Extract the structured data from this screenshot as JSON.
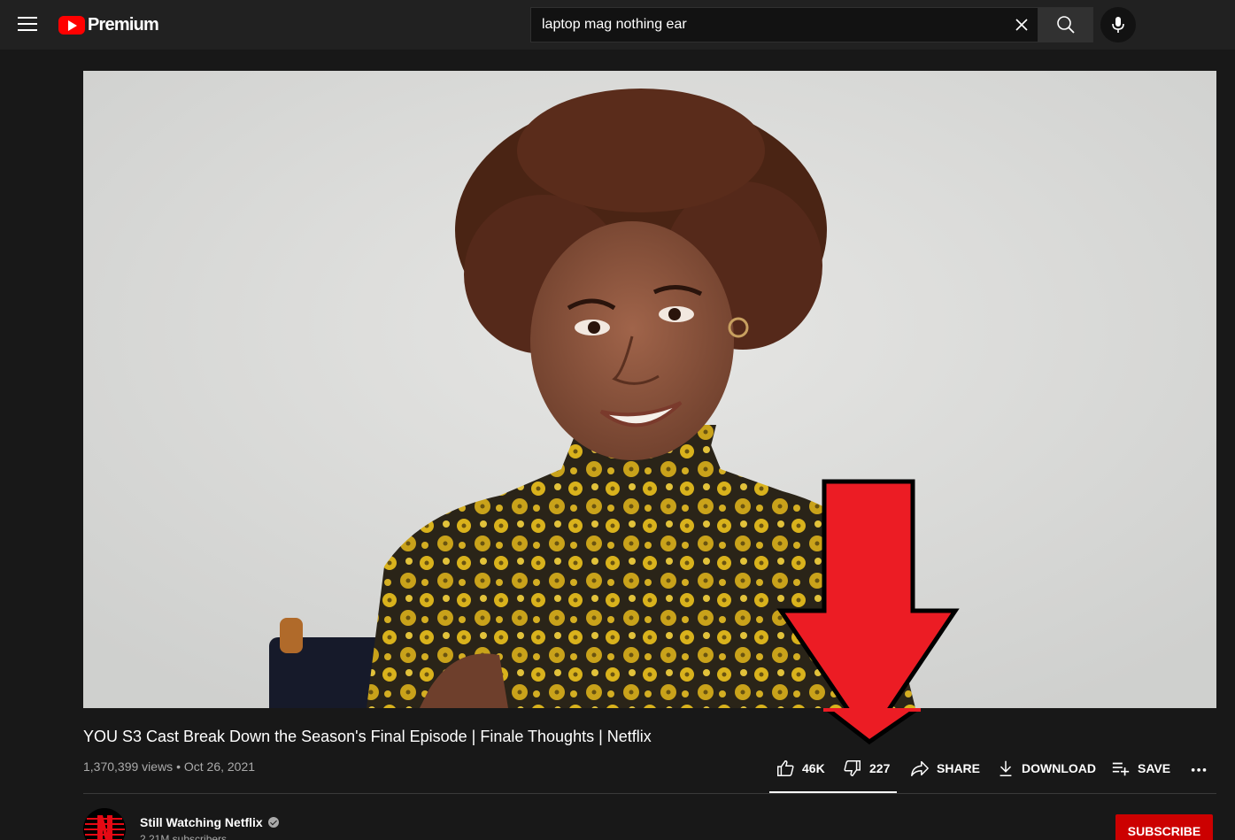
{
  "header": {
    "logo_text": "Premium",
    "search_value": "laptop mag nothing ear"
  },
  "video": {
    "title": "YOU S3 Cast Break Down the Season's Final Episode | Finale Thoughts | Netflix",
    "views": "1,370,399 views",
    "separator": "•",
    "date": "Oct 26, 2021"
  },
  "actions": {
    "likes": "46K",
    "dislikes": "227",
    "share": "SHARE",
    "download": "DOWNLOAD",
    "save": "SAVE",
    "more": "…"
  },
  "channel": {
    "name": "Still Watching Netflix",
    "subscribers": "2.21M subscribers",
    "subscribe_label": "SUBSCRIBE"
  },
  "colors": {
    "background": "#181818",
    "topbar": "#212121",
    "brand_red": "#ff0000",
    "subscribe_red": "#cc0000",
    "annotation_arrow": "#ec1c24"
  },
  "icons": [
    "menu-icon",
    "youtube-logo-icon",
    "clear-icon",
    "search-icon",
    "mic-icon",
    "like-icon",
    "dislike-icon",
    "share-icon",
    "download-icon",
    "save-playlist-icon",
    "more-icon",
    "verified-icon",
    "netflix-logo-icon"
  ]
}
